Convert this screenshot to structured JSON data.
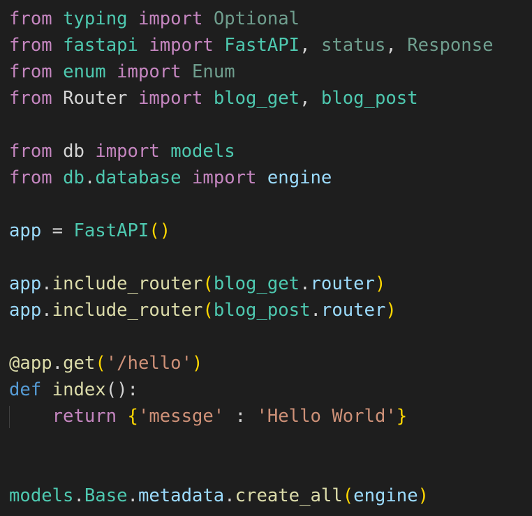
{
  "colors": {
    "background": "#1e1e1e",
    "default": "#d4d4d4",
    "keyword": "#c586c0",
    "storage": "#569cd6",
    "variable": "#9cdcfe",
    "class": "#4ec9b0",
    "function": "#dcdcaa",
    "string": "#ce9178",
    "bracket": "#ffd700",
    "paren": "#da70d6",
    "module": "#4ec9b0",
    "dim": "#6f9e8e",
    "indent_guide": "#404040"
  },
  "top_fragment": [
    {
      "t": "    ",
      "c": "default"
    },
    {
      "t": "  ",
      "c": "default"
    }
  ],
  "lines": [
    [
      {
        "t": "from",
        "c": "keyword"
      },
      {
        "t": " ",
        "c": "default"
      },
      {
        "t": "typing",
        "c": "module"
      },
      {
        "t": " ",
        "c": "default"
      },
      {
        "t": "import",
        "c": "keyword"
      },
      {
        "t": " ",
        "c": "default"
      },
      {
        "t": "Optional",
        "c": "dim"
      }
    ],
    [
      {
        "t": "from",
        "c": "keyword"
      },
      {
        "t": " ",
        "c": "default"
      },
      {
        "t": "fastapi",
        "c": "module"
      },
      {
        "t": " ",
        "c": "default"
      },
      {
        "t": "import",
        "c": "keyword"
      },
      {
        "t": " ",
        "c": "default"
      },
      {
        "t": "FastAPI",
        "c": "class"
      },
      {
        "t": ", ",
        "c": "default"
      },
      {
        "t": "status",
        "c": "dim"
      },
      {
        "t": ", ",
        "c": "default"
      },
      {
        "t": "Response",
        "c": "dim"
      }
    ],
    [
      {
        "t": "from",
        "c": "keyword"
      },
      {
        "t": " ",
        "c": "default"
      },
      {
        "t": "enum",
        "c": "module"
      },
      {
        "t": " ",
        "c": "default"
      },
      {
        "t": "import",
        "c": "keyword"
      },
      {
        "t": " ",
        "c": "default"
      },
      {
        "t": "Enum",
        "c": "dim"
      }
    ],
    [
      {
        "t": "from",
        "c": "keyword"
      },
      {
        "t": " ",
        "c": "default"
      },
      {
        "t": "Router",
        "c": "default"
      },
      {
        "t": " ",
        "c": "default"
      },
      {
        "t": "import",
        "c": "keyword"
      },
      {
        "t": " ",
        "c": "default"
      },
      {
        "t": "blog_get",
        "c": "module"
      },
      {
        "t": ", ",
        "c": "default"
      },
      {
        "t": "blog_post",
        "c": "module"
      }
    ],
    [],
    [
      {
        "t": "from",
        "c": "keyword"
      },
      {
        "t": " ",
        "c": "default"
      },
      {
        "t": "db",
        "c": "default"
      },
      {
        "t": " ",
        "c": "default"
      },
      {
        "t": "import",
        "c": "keyword"
      },
      {
        "t": " ",
        "c": "default"
      },
      {
        "t": "models",
        "c": "module"
      }
    ],
    [
      {
        "t": "from",
        "c": "keyword"
      },
      {
        "t": " ",
        "c": "default"
      },
      {
        "t": "db",
        "c": "module"
      },
      {
        "t": ".",
        "c": "default"
      },
      {
        "t": "database",
        "c": "module"
      },
      {
        "t": " ",
        "c": "default"
      },
      {
        "t": "import",
        "c": "keyword"
      },
      {
        "t": " ",
        "c": "default"
      },
      {
        "t": "engine",
        "c": "variable"
      }
    ],
    [],
    [
      {
        "t": "app",
        "c": "variable"
      },
      {
        "t": " = ",
        "c": "default"
      },
      {
        "t": "FastAPI",
        "c": "class"
      },
      {
        "t": "()",
        "c": "bracket"
      }
    ],
    [],
    [
      {
        "t": "app",
        "c": "variable"
      },
      {
        "t": ".",
        "c": "default"
      },
      {
        "t": "include_router",
        "c": "function"
      },
      {
        "t": "(",
        "c": "bracket"
      },
      {
        "t": "blog_get",
        "c": "module"
      },
      {
        "t": ".",
        "c": "default"
      },
      {
        "t": "router",
        "c": "variable"
      },
      {
        "t": ")",
        "c": "bracket"
      }
    ],
    [
      {
        "t": "app",
        "c": "variable"
      },
      {
        "t": ".",
        "c": "default"
      },
      {
        "t": "include_router",
        "c": "function"
      },
      {
        "t": "(",
        "c": "bracket"
      },
      {
        "t": "blog_post",
        "c": "module"
      },
      {
        "t": ".",
        "c": "default"
      },
      {
        "t": "router",
        "c": "variable"
      },
      {
        "t": ")",
        "c": "bracket"
      }
    ],
    [],
    [
      {
        "t": "@",
        "c": "function"
      },
      {
        "t": "app",
        "c": "function"
      },
      {
        "t": ".",
        "c": "default"
      },
      {
        "t": "get",
        "c": "function"
      },
      {
        "t": "(",
        "c": "bracket"
      },
      {
        "t": "'/hello'",
        "c": "string"
      },
      {
        "t": ")",
        "c": "bracket"
      }
    ],
    [
      {
        "t": "def",
        "c": "storage"
      },
      {
        "t": " ",
        "c": "default"
      },
      {
        "t": "index",
        "c": "function"
      },
      {
        "t": "():",
        "c": "default"
      }
    ],
    [
      {
        "t": "    ",
        "c": "default"
      },
      {
        "t": "return",
        "c": "keyword"
      },
      {
        "t": " ",
        "c": "default"
      },
      {
        "t": "{",
        "c": "bracket"
      },
      {
        "t": "'messge'",
        "c": "string"
      },
      {
        "t": " : ",
        "c": "default"
      },
      {
        "t": "'Hello World'",
        "c": "string"
      },
      {
        "t": "}",
        "c": "bracket"
      }
    ],
    [],
    [],
    [
      {
        "t": "models",
        "c": "module"
      },
      {
        "t": ".",
        "c": "default"
      },
      {
        "t": "Base",
        "c": "module"
      },
      {
        "t": ".",
        "c": "default"
      },
      {
        "t": "metadata",
        "c": "variable"
      },
      {
        "t": ".",
        "c": "default"
      },
      {
        "t": "create_all",
        "c": "function"
      },
      {
        "t": "(",
        "c": "bracket"
      },
      {
        "t": "engine",
        "c": "variable"
      },
      {
        "t": ")",
        "c": "bracket"
      }
    ]
  ]
}
